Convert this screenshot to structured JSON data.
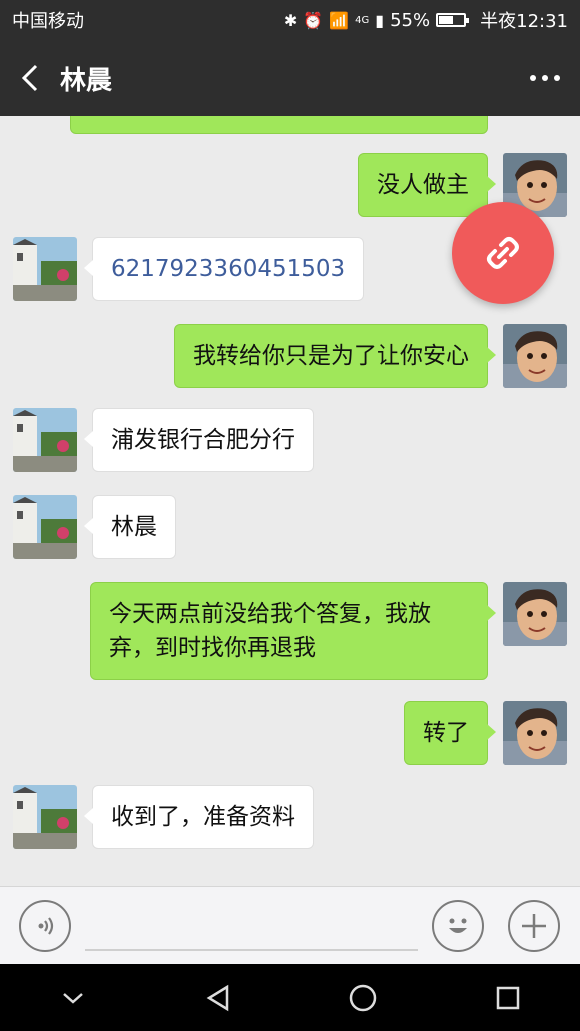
{
  "status_bar": {
    "carrier": "中国移动",
    "network": "4G",
    "battery_percent": "55%",
    "time": "半夜12:31"
  },
  "header": {
    "title": "林晨"
  },
  "messages": [
    {
      "side": "right",
      "text": "没人做主"
    },
    {
      "side": "left",
      "text": "6217923360451503",
      "style": "link"
    },
    {
      "side": "right",
      "text": "我转给你只是为了让你安心"
    },
    {
      "side": "left",
      "text": "浦发银行合肥分行"
    },
    {
      "side": "left",
      "text": "林晨"
    },
    {
      "side": "right",
      "text": "今天两点前没给我个答复，我放弃，到时找你再退我"
    },
    {
      "side": "right",
      "text": "转了"
    },
    {
      "side": "left",
      "text": "收到了，准备资料"
    }
  ],
  "colors": {
    "bar_bg": "#2e2e2e",
    "chat_bg": "#ebebeb",
    "sent_bubble": "#a0e75a",
    "received_bubble": "#ffffff",
    "link_text": "#3e5d9b",
    "fab": "#f05a5a"
  },
  "icons": {
    "back": "chevron-left-icon",
    "more": "more-dots-icon",
    "fab": "link-icon",
    "voice": "voice-icon",
    "emoji": "smiley-icon",
    "plus": "plus-icon",
    "nav": [
      "chevron-down-icon",
      "back-triangle-icon",
      "home-circle-icon",
      "recents-square-icon"
    ]
  }
}
